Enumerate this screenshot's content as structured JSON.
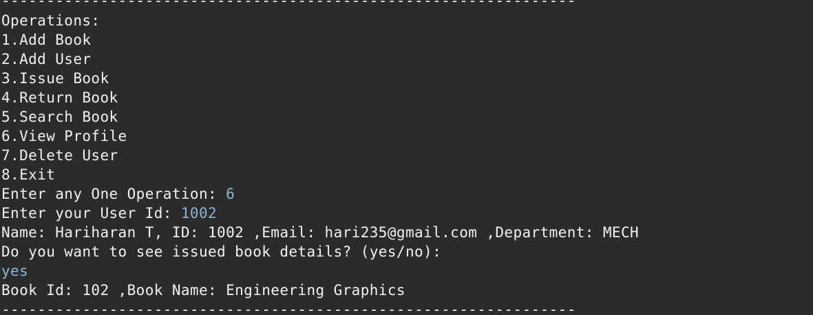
{
  "terminal": {
    "top_rule": "----------------------------------------------------------------",
    "operations_header": "Operations:",
    "menu": [
      "1.Add Book",
      "2.Add User",
      "3.Issue Book",
      "4.Return Book",
      "5.Search Book",
      "6.View Profile",
      "7.Delete User",
      "8.Exit"
    ],
    "operation_prompt": "Enter any One Operation: ",
    "operation_input": "6",
    "user_id_prompt": "Enter your User Id: ",
    "user_id_input": "1002",
    "profile_line": "Name: Hariharan T, ID: 1002 ,Email: hari235@gmail.com ,Department: MECH",
    "issued_prompt": "Do you want to see issued book details? (yes/no):",
    "issued_input": "yes",
    "book_line": "Book Id: 102 ,Book Name: Engineering Graphics",
    "bottom_rule": "----------------------------------------------------------------"
  },
  "colors": {
    "background": "#2b2b2b",
    "output_text": "#f2f2f2",
    "user_input_text": "#8fb4d8"
  }
}
